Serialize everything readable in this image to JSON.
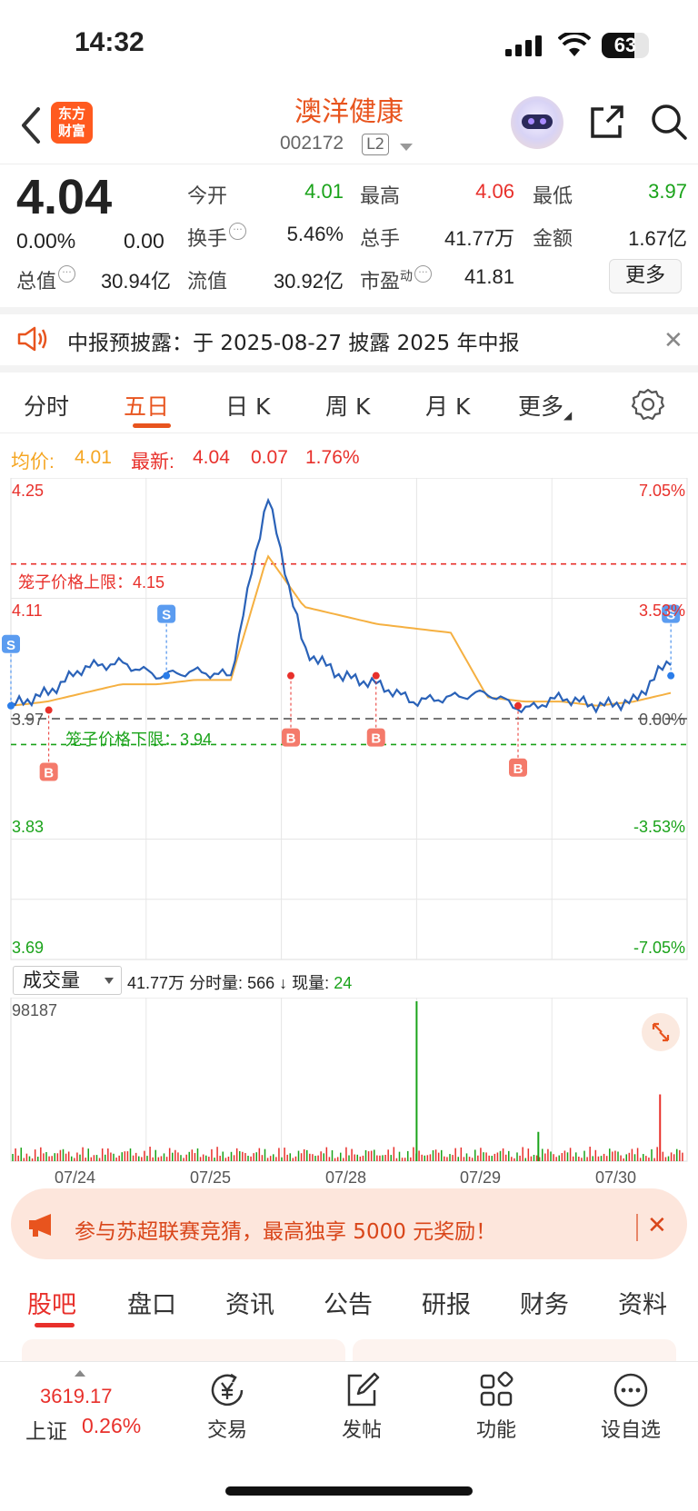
{
  "status": {
    "time": "14:32",
    "battery": "63"
  },
  "header": {
    "name": "澳洋健康",
    "code": "002172",
    "badge": "L2",
    "logo_line1": "东方",
    "logo_line2": "财富"
  },
  "quote": {
    "price": "4.04",
    "pct": "0.00%",
    "change": "0.00",
    "rows": [
      [
        {
          "label": "今开",
          "value": "4.01",
          "color": "green"
        },
        {
          "label": "最高",
          "value": "4.06",
          "color": "red"
        },
        {
          "label": "最低",
          "value": "3.97",
          "color": "green"
        }
      ],
      [
        {
          "label": "换手",
          "value": "5.46%",
          "color": ""
        },
        {
          "label": "总手",
          "value": "41.77万",
          "color": ""
        },
        {
          "label": "金额",
          "value": "1.67亿",
          "color": ""
        }
      ],
      [
        {
          "label": "总值",
          "value": "30.94亿",
          "color": ""
        },
        {
          "label": "流值",
          "value": "30.92亿",
          "color": ""
        },
        {
          "label": "市盈",
          "value": "41.81",
          "color": ""
        }
      ]
    ],
    "pe_superscript": "动",
    "more": "更多"
  },
  "notice": {
    "text": "中报预披露：于 2025-08-27 披露 2025 年中报"
  },
  "tabs": {
    "items": [
      "分时",
      "五日",
      "日 K",
      "周 K",
      "月 K",
      "更多"
    ],
    "active": 1
  },
  "chart_head": {
    "avg_label": "均价:",
    "avg": "4.01",
    "latest_label": "最新:",
    "latest": "4.04",
    "chg": "0.07",
    "pct": "1.76%"
  },
  "chart_data": {
    "type": "line",
    "title": "",
    "x": [
      "07/24",
      "07/25",
      "07/28",
      "07/29",
      "07/30"
    ],
    "price_axis_left": [
      "4.25",
      "4.11",
      "3.97",
      "3.83",
      "3.69"
    ],
    "pct_axis_right": [
      "7.05%",
      "3.53%",
      "0.00%",
      "-3.53%",
      "-7.05%"
    ],
    "ylim": [
      3.69,
      4.25
    ],
    "prev_close": 3.97,
    "upper_limit": {
      "label": "笼子价格上限：4.15",
      "value": 4.15
    },
    "lower_limit": {
      "label": "笼子价格下限：3.94",
      "value": 3.94
    },
    "series": [
      {
        "name": "最新",
        "values": [
          3.985,
          4.0,
          4.03,
          4.035,
          4.02,
          4.025,
          4.02,
          4.23,
          4.05,
          4.02,
          4.01,
          3.99,
          3.995,
          4.0,
          3.98,
          3.995,
          3.985,
          3.99,
          4.04
        ]
      },
      {
        "name": "均价",
        "values": [
          3.985,
          3.99,
          4.0,
          4.01,
          4.01,
          4.015,
          4.015,
          4.16,
          4.1,
          4.09,
          4.08,
          4.075,
          4.07,
          3.995,
          3.99,
          3.99,
          3.985,
          3.99,
          4.0
        ]
      }
    ],
    "trade_markers": [
      {
        "label": "S",
        "day": 0.0,
        "price": 3.985
      },
      {
        "label": "B",
        "day": 0.28,
        "price": 3.98
      },
      {
        "label": "S",
        "day": 1.15,
        "price": 4.02
      },
      {
        "label": "B",
        "day": 2.07,
        "price": 4.02
      },
      {
        "label": "B",
        "day": 2.7,
        "price": 4.02
      },
      {
        "label": "B",
        "day": 3.75,
        "price": 3.985
      },
      {
        "label": "S",
        "day": 4.88,
        "price": 4.02
      }
    ],
    "volume": {
      "max_label": "98187",
      "ylim": [
        0,
        98187
      ],
      "spikes": [
        {
          "day": 3.0,
          "value": 98187,
          "color": "green"
        },
        {
          "day": 4.8,
          "value": 41000,
          "color": "red"
        },
        {
          "day": 3.9,
          "value": 18000,
          "color": "green"
        }
      ]
    }
  },
  "volume_head": {
    "select": "成交量",
    "total": "41.77万",
    "tick_label": "分时量:",
    "tick": "566",
    "arrow": "↓",
    "now_label": "现量:",
    "now": "24"
  },
  "promo": {
    "text": "参与苏超联赛竞猜，最高独享 5000 元奖励！"
  },
  "bottom_tabs": {
    "items": [
      "股吧",
      "盘口",
      "资讯",
      "公告",
      "研报",
      "财务",
      "资料"
    ],
    "active": 0
  },
  "navbar": {
    "index_value": "3619.17",
    "index_name": "上证",
    "index_pct": "0.26%",
    "items": [
      {
        "label": "交易",
        "icon": "trade-yen-icon"
      },
      {
        "label": "发帖",
        "icon": "edit-icon"
      },
      {
        "label": "功能",
        "icon": "grid-icon"
      },
      {
        "label": "设自选",
        "icon": "more-dots-icon"
      }
    ]
  }
}
